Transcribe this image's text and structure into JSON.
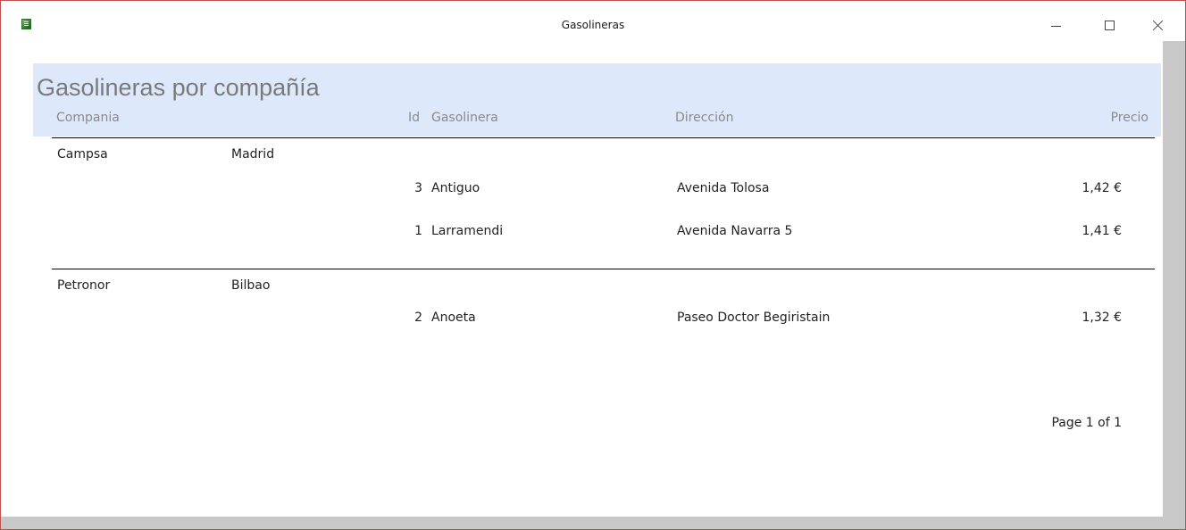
{
  "window": {
    "title": "Gasolineras"
  },
  "report": {
    "title": "Gasolineras por compañía",
    "columns": {
      "compania": "Compania",
      "id": "Id",
      "gasolinera": "Gasolinera",
      "direccion": "Dirección",
      "precio": "Precio"
    },
    "groups": [
      {
        "compania": "Campsa",
        "ciudad": "Madrid",
        "rows": [
          {
            "id": "3",
            "gasolinera": "Antiguo",
            "direccion": "Avenida Tolosa",
            "precio": "1,42 €"
          },
          {
            "id": "1",
            "gasolinera": "Larramendi",
            "direccion": "Avenida Navarra 5",
            "precio": "1,41 €"
          }
        ]
      },
      {
        "compania": "Petronor",
        "ciudad": "Bilbao",
        "rows": [
          {
            "id": "2",
            "gasolinera": "Anoeta",
            "direccion": "Paseo Doctor Begiristain",
            "precio": "1,32 €"
          }
        ]
      }
    ],
    "footer": "Page 1 of 1"
  },
  "icons": {
    "app": "access-report-icon",
    "minimize": "minimize-icon",
    "maximize": "maximize-icon",
    "close": "close-icon"
  },
  "colors": {
    "header_band": "#dde9fb",
    "window_border": "#c0504d"
  }
}
